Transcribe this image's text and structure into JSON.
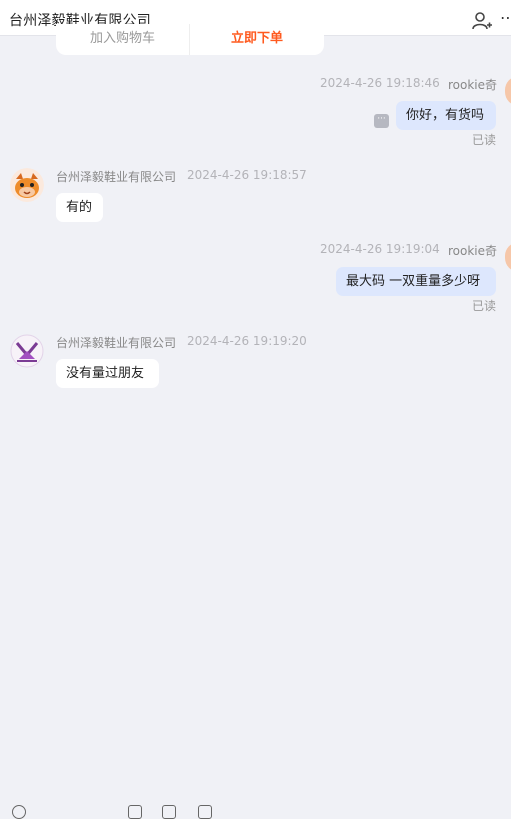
{
  "header": {
    "title": "台州泽毅鞋业有限公司",
    "more_label": "⋯"
  },
  "prev_card": {
    "left_label": "加入购物车",
    "right_label": "立即下单"
  },
  "messages": [
    {
      "side": "right",
      "name": "rookie奇",
      "time": "2024-4-26 19:18:46",
      "text": "你好，有货吗",
      "status": "已读"
    },
    {
      "side": "left",
      "name": "台州泽毅鞋业有限公司",
      "time": "2024-4-26 19:18:57",
      "text": "有的"
    },
    {
      "side": "right",
      "name": "rookie奇",
      "time": "2024-4-26 19:19:04",
      "text": "最大码  一双重量多少呀",
      "status": "已读"
    },
    {
      "side": "left",
      "name": "台州泽毅鞋业有限公司",
      "time": "2024-4-26 19:19:20",
      "text": "没有量过朋友"
    }
  ],
  "more_icon_label": "···",
  "colors": {
    "background": "#f0f1f6",
    "my_bubble": "#dde7fd",
    "their_bubble": "#ffffff",
    "accent": "#ff5a1f"
  }
}
